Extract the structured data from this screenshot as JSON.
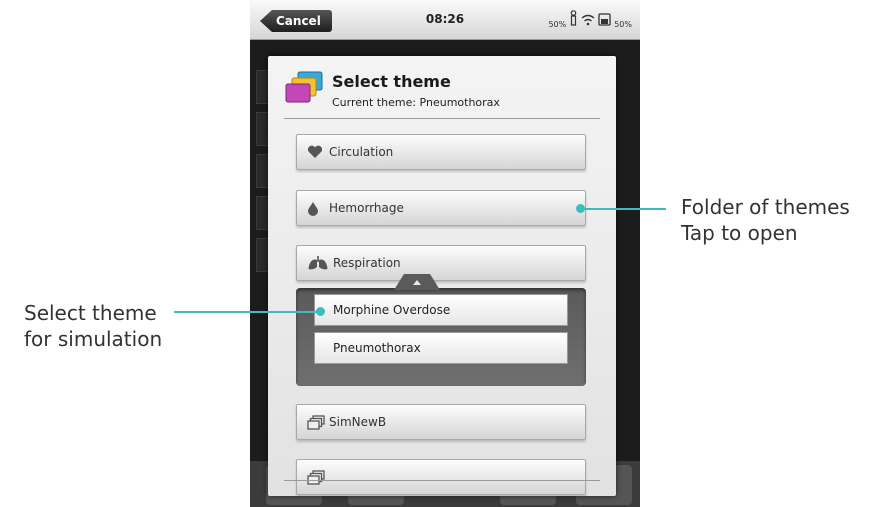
{
  "statusbar": {
    "cancel_label": "Cancel",
    "time": "08:26",
    "battery_left": "50%",
    "battery_right": "50%"
  },
  "dialog": {
    "title": "Select theme",
    "subtitle": "Current theme: Pneumothorax",
    "folders": [
      {
        "label": "Circulation",
        "icon": "heart-icon"
      },
      {
        "label": "Hemorrhage",
        "icon": "drop-icon"
      },
      {
        "label": "Respiration",
        "icon": "lungs-icon"
      },
      {
        "label": "SimNewB",
        "icon": "windows-icon"
      }
    ],
    "themes": [
      {
        "label": "Morphine Overdose"
      },
      {
        "label": "Pneumothorax"
      }
    ]
  },
  "annotations": {
    "folder_line1": "Folder of themes",
    "folder_line2": "Tap to open",
    "select_line1": "Select theme",
    "select_line2": "for simulation"
  },
  "colors": {
    "accent": "#3cbcbc",
    "panel": "#5a5a5a"
  }
}
